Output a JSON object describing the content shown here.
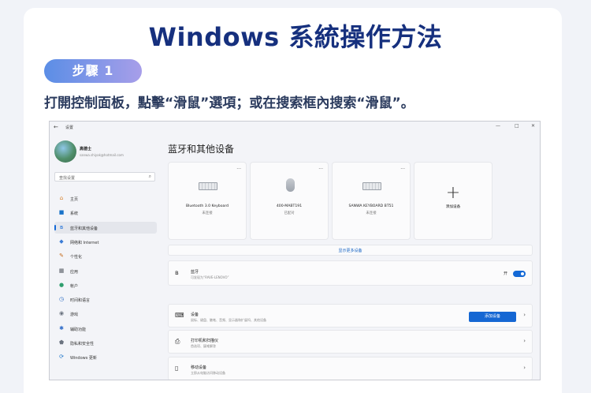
{
  "header": {
    "title": "Windows 系統操作方法",
    "step_label": "步驟 1",
    "instruction": "打開控制面板，點擊“滑鼠”選項；或在搜索框內搜索“滑鼠”。"
  },
  "window": {
    "back_icon": "←",
    "app_title": "设置",
    "controls": {
      "minimize": "—",
      "maximize": "□",
      "close": "✕"
    }
  },
  "user": {
    "name": "高德士",
    "email": "sanwa.shiyak@hotmail.com"
  },
  "search": {
    "placeholder": "查找设置",
    "icon": "search-icon"
  },
  "sidebar": {
    "items": [
      {
        "label": "主页",
        "icon": "home-icon",
        "glyph": "⌂",
        "color": "#d9822b"
      },
      {
        "label": "系统",
        "icon": "system-icon",
        "glyph": "■",
        "color": "#1a73c9"
      },
      {
        "label": "蓝牙和其他设备",
        "icon": "bluetooth-icon",
        "glyph": "ʙ",
        "color": "#1469d6",
        "active": true
      },
      {
        "label": "网络和 Internet",
        "icon": "network-icon",
        "glyph": "◆",
        "color": "#3a7bd5"
      },
      {
        "label": "个性化",
        "icon": "personalization-icon",
        "glyph": "✎",
        "color": "#c46a1a"
      },
      {
        "label": "应用",
        "icon": "apps-icon",
        "glyph": "▦",
        "color": "#555a63"
      },
      {
        "label": "帐户",
        "icon": "account-icon",
        "glyph": "●",
        "color": "#2f9e6e"
      },
      {
        "label": "时间和语言",
        "icon": "time-language-icon",
        "glyph": "◷",
        "color": "#2b6cc4"
      },
      {
        "label": "游戏",
        "icon": "gaming-icon",
        "glyph": "◉",
        "color": "#6b7380"
      },
      {
        "label": "辅助功能",
        "icon": "accessibility-icon",
        "glyph": "✱",
        "color": "#2d6ac8"
      },
      {
        "label": "隐私和安全性",
        "icon": "privacy-icon",
        "glyph": "⬟",
        "color": "#6b7380"
      },
      {
        "label": "Windows 更新",
        "icon": "windows-update-icon",
        "glyph": "⟳",
        "color": "#1a73c9"
      }
    ]
  },
  "main": {
    "title": "蓝牙和其他设备",
    "devices": [
      {
        "name": "Bluetooth 3.0 Keyboard",
        "status": "未连接",
        "type": "keyboard"
      },
      {
        "name": "400-MABT191",
        "status": "已配对",
        "type": "mouse"
      },
      {
        "name": "SANWA KEYBOARD BT51",
        "status": "未连接",
        "type": "keyboard"
      }
    ],
    "add_device_card": {
      "label": "添加设备"
    },
    "card_menu": "...",
    "show_more": "显示更多设备",
    "bluetooth": {
      "title": "蓝牙",
      "subtitle": "可发现为“RAVE-LENOVO”",
      "toggle_label": "开"
    },
    "rows": [
      {
        "title": "设备",
        "subtitle": "鼠标、键盘、触笔、音频、显示器和扩展坞、其他设备",
        "button": "添加设备",
        "icon": "devices-icon"
      },
      {
        "title": "打印机和扫描仪",
        "subtitle": "首选项、疑难解答",
        "icon": "printer-icon"
      },
      {
        "title": "移动设备",
        "subtitle": "立即从电脑访问移动设备",
        "icon": "phone-icon"
      }
    ],
    "chevron": "›"
  }
}
